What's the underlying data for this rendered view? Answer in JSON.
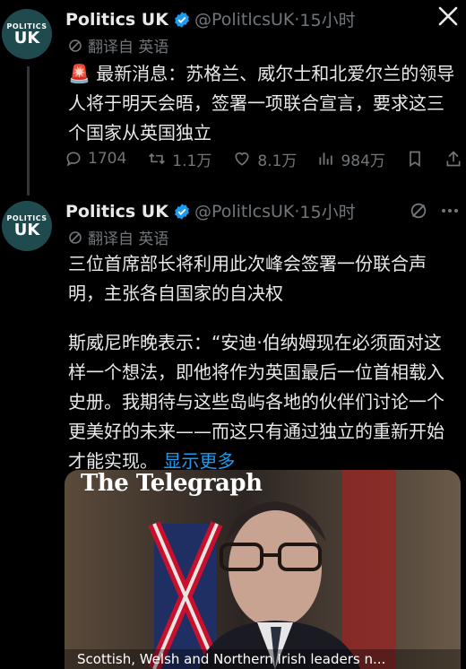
{
  "colors": {
    "background": "#000000",
    "text": "#e7e9ea",
    "muted": "#71767b",
    "link": "#1d9bf0",
    "verified": "#1d9bf0",
    "avatar_bg": "#1f4b4f"
  },
  "tweet1": {
    "avatar": {
      "line1": "POLITICS",
      "line2": "UK"
    },
    "name": "Politics UK",
    "handle": "@PolitlcsUK",
    "separator": "·",
    "time": "15小时",
    "translate_label": "翻译自 英语",
    "alert_icon": "🚨",
    "text": "最新消息：苏格兰、威尔士和北爱尔兰的领导人将于明天会晤，签署一项联合宣言，要求这三个国家从英国独立",
    "stats": {
      "replies": "1704",
      "retweets": "1.1万",
      "likes": "8.1万",
      "views": "984万"
    },
    "icons": [
      "x-logo-icon",
      "reply-icon",
      "retweet-icon",
      "like-icon",
      "views-icon",
      "bookmark-icon",
      "share-icon"
    ]
  },
  "tweet2": {
    "avatar": {
      "line1": "POLITICS",
      "line2": "UK"
    },
    "name": "Politics UK",
    "handle": "@PolitlcsUK",
    "separator": "·",
    "time": "15小时",
    "translate_label": "翻译自 英语",
    "paragraph1": "三位首席部长将利用此次峰会签署一份联合声明，主张各自国家的自决权",
    "paragraph2": "斯威尼昨晚表示：“安迪·伯纳姆现在必须面对这样一个想法，即他将作为英国最后一位首相载入史册。我期待与这些岛屿各地的伙伴们讨论一个更美好的未来——而这只有通过独立的重新开始才能实现。",
    "show_more": "显示更多",
    "media": {
      "brand": "The Telegraph",
      "caption": "Scottish, Welsh and Northern Irish leaders n..."
    },
    "icons": [
      "grok-icon",
      "more-icon"
    ]
  }
}
